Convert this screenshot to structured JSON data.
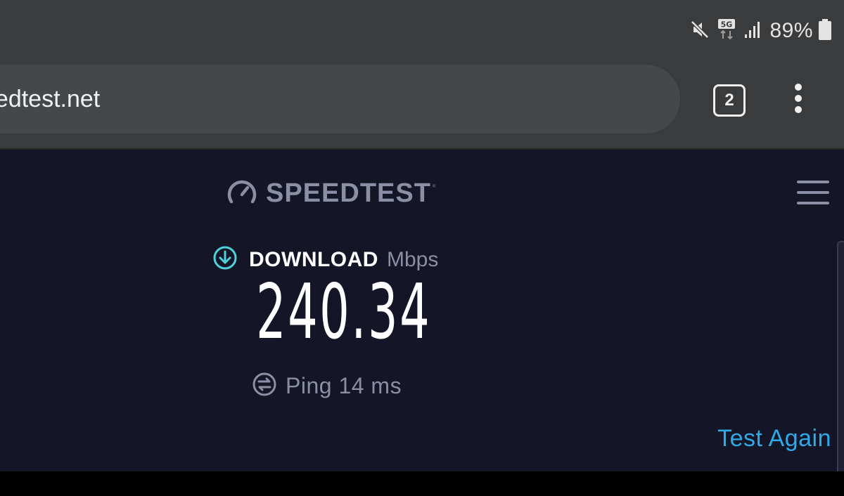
{
  "status_bar": {
    "battery_percent": "89%",
    "network_label": "5G",
    "icons": [
      "mute-icon",
      "5g-icon",
      "signal-icon",
      "battery-icon"
    ]
  },
  "browser": {
    "url": "eedtest.net",
    "tab_count": "2",
    "icons": [
      "overflow-menu-icon"
    ]
  },
  "speedtest": {
    "logo_text": "SPEEDTEST",
    "logo_tm": "®",
    "download_label": "DOWNLOAD",
    "download_unit": "Mbps",
    "download_value": "240.34",
    "ping_text": "Ping 14 ms",
    "test_again_label": "Test Again",
    "icons": [
      "speedometer-icon",
      "download-arrow-icon",
      "ping-icon",
      "hamburger-menu-icon"
    ]
  },
  "colors": {
    "page_background": "#141628",
    "accent_teal": "#4fd1d9",
    "link_blue": "#2fa9e8",
    "muted_text": "#8a8fa5",
    "chrome_gray": "#3a3b3d"
  }
}
